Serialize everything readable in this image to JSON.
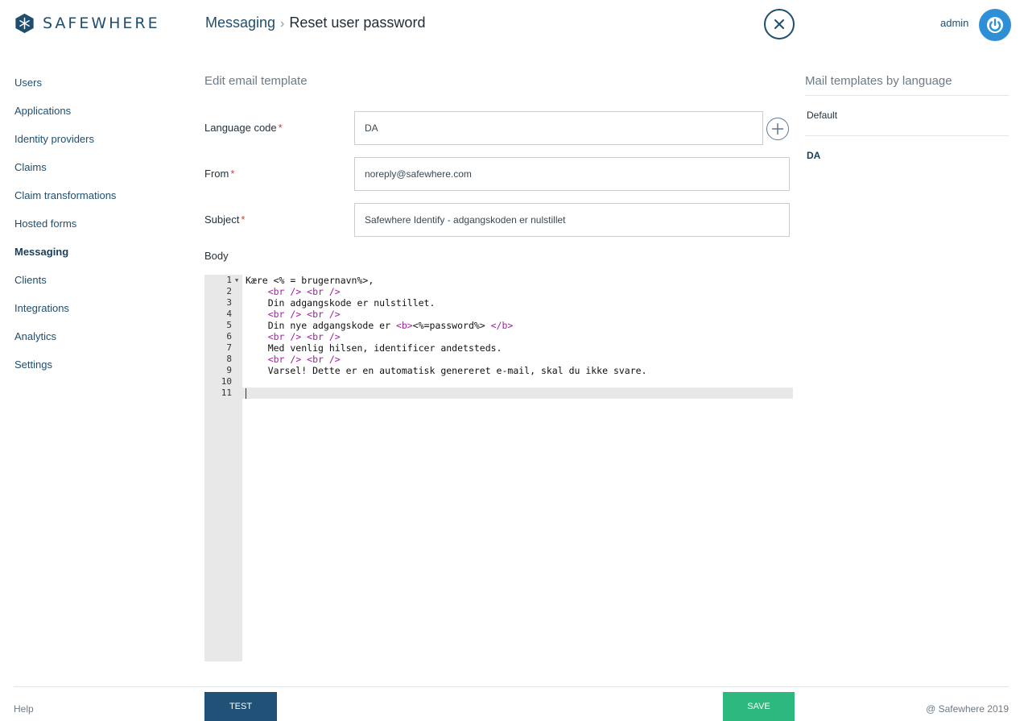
{
  "header": {
    "logo_text": "SAFEWHERE",
    "breadcrumb_parent": "Messaging",
    "breadcrumb_separator": "›",
    "breadcrumb_current": "Reset user password",
    "user_name": "admin"
  },
  "sidebar": {
    "items": [
      {
        "label": "Users"
      },
      {
        "label": "Applications"
      },
      {
        "label": "Identity providers"
      },
      {
        "label": "Claims"
      },
      {
        "label": "Claim transformations"
      },
      {
        "label": "Hosted forms"
      },
      {
        "label": "Messaging",
        "active": true
      },
      {
        "label": "Clients"
      },
      {
        "label": "Integrations"
      },
      {
        "label": "Analytics"
      },
      {
        "label": "Settings"
      }
    ]
  },
  "form": {
    "title": "Edit email template",
    "language_code_label": "Language code",
    "language_code_value": "DA",
    "from_label": "From",
    "from_value": "noreply@safewhere.com",
    "subject_label": "Subject",
    "subject_value": "Safewhere Identify - adgangskoden er nulstillet",
    "body_label": "Body",
    "required_mark": "*"
  },
  "editor": {
    "lines": [
      {
        "num": "1",
        "text": "Kære <% = brugernavn%>,"
      },
      {
        "num": "2",
        "text": "    <br /> <br />"
      },
      {
        "num": "3",
        "text": "    Din adgangskode er nulstillet."
      },
      {
        "num": "4",
        "text": "    <br /> <br />"
      },
      {
        "num": "5",
        "text": "    Din nye adgangskode er <b><%=password%> </b>"
      },
      {
        "num": "6",
        "text": "    <br /> <br />"
      },
      {
        "num": "7",
        "text": "    Med venlig hilsen, identificer andetsteds."
      },
      {
        "num": "8",
        "text": "    <br /> <br />"
      },
      {
        "num": "9",
        "text": "    Varsel! Dette er en automatisk genereret e-mail, skal du ikke svare."
      },
      {
        "num": "10",
        "text": ""
      },
      {
        "num": "11",
        "text": ""
      }
    ],
    "current_line": 11
  },
  "right_panel": {
    "title": "Mail templates by language",
    "items": [
      {
        "label": "Default"
      },
      {
        "label": "DA",
        "active": true
      }
    ]
  },
  "footer": {
    "help": "Help",
    "test_label": "TEST",
    "save_label": "SAVE",
    "copyright": "@ Safewhere 2019"
  },
  "colors": {
    "brand": "#1f4e6f",
    "accent_blue": "#2f8fd6",
    "save_green": "#2db87f",
    "test_blue": "#1f5276",
    "required_red": "#d33b3b",
    "html_tag": "#a020a0"
  },
  "icons": [
    "logo-icon",
    "close-icon",
    "power-icon",
    "plus-icon",
    "fold-arrow-icon"
  ]
}
